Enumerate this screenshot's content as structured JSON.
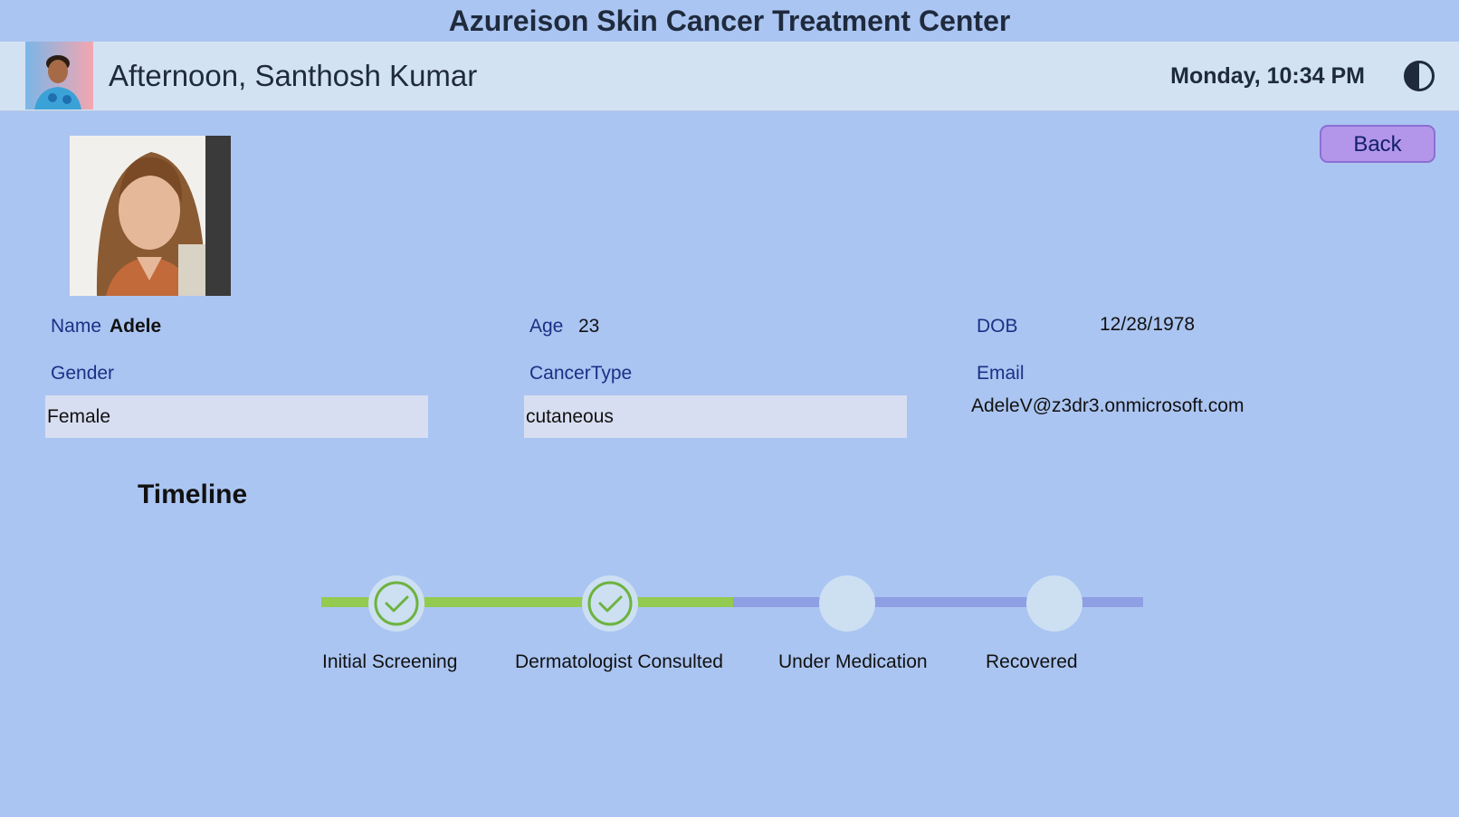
{
  "app": {
    "title": "Azureison Skin Cancer Treatment Center"
  },
  "header": {
    "greeting": "Afternoon, Santhosh Kumar",
    "datetime": "Monday, 10:34 PM"
  },
  "actions": {
    "back_label": "Back"
  },
  "patient": {
    "name_label": "Name",
    "name": "Adele",
    "age_label": "Age",
    "age": "23",
    "dob_label": "DOB",
    "dob": "12/28/1978",
    "gender_label": "Gender",
    "gender": "Female",
    "cancer_type_label": "CancerType",
    "cancer_type": "cutaneous",
    "email_label": "Email",
    "email": "AdeleV@z3dr3.onmicrosoft.com"
  },
  "timeline": {
    "title": "Timeline",
    "steps": [
      {
        "label": "Initial Screening",
        "done": true
      },
      {
        "label": "Dermatologist Consulted",
        "done": true
      },
      {
        "label": "Under Medication",
        "done": false
      },
      {
        "label": "Recovered",
        "done": false
      }
    ]
  },
  "colors": {
    "background": "#abc5f2",
    "header_bar": "#d3e2f3",
    "progress_done": "#92cb4f",
    "progress_todo": "#8e9fe3",
    "check_green": "#6db33f",
    "button": "#b396ea"
  },
  "icons": {
    "theme_toggle": "half-circle-contrast-icon",
    "check": "checkmark-icon"
  }
}
